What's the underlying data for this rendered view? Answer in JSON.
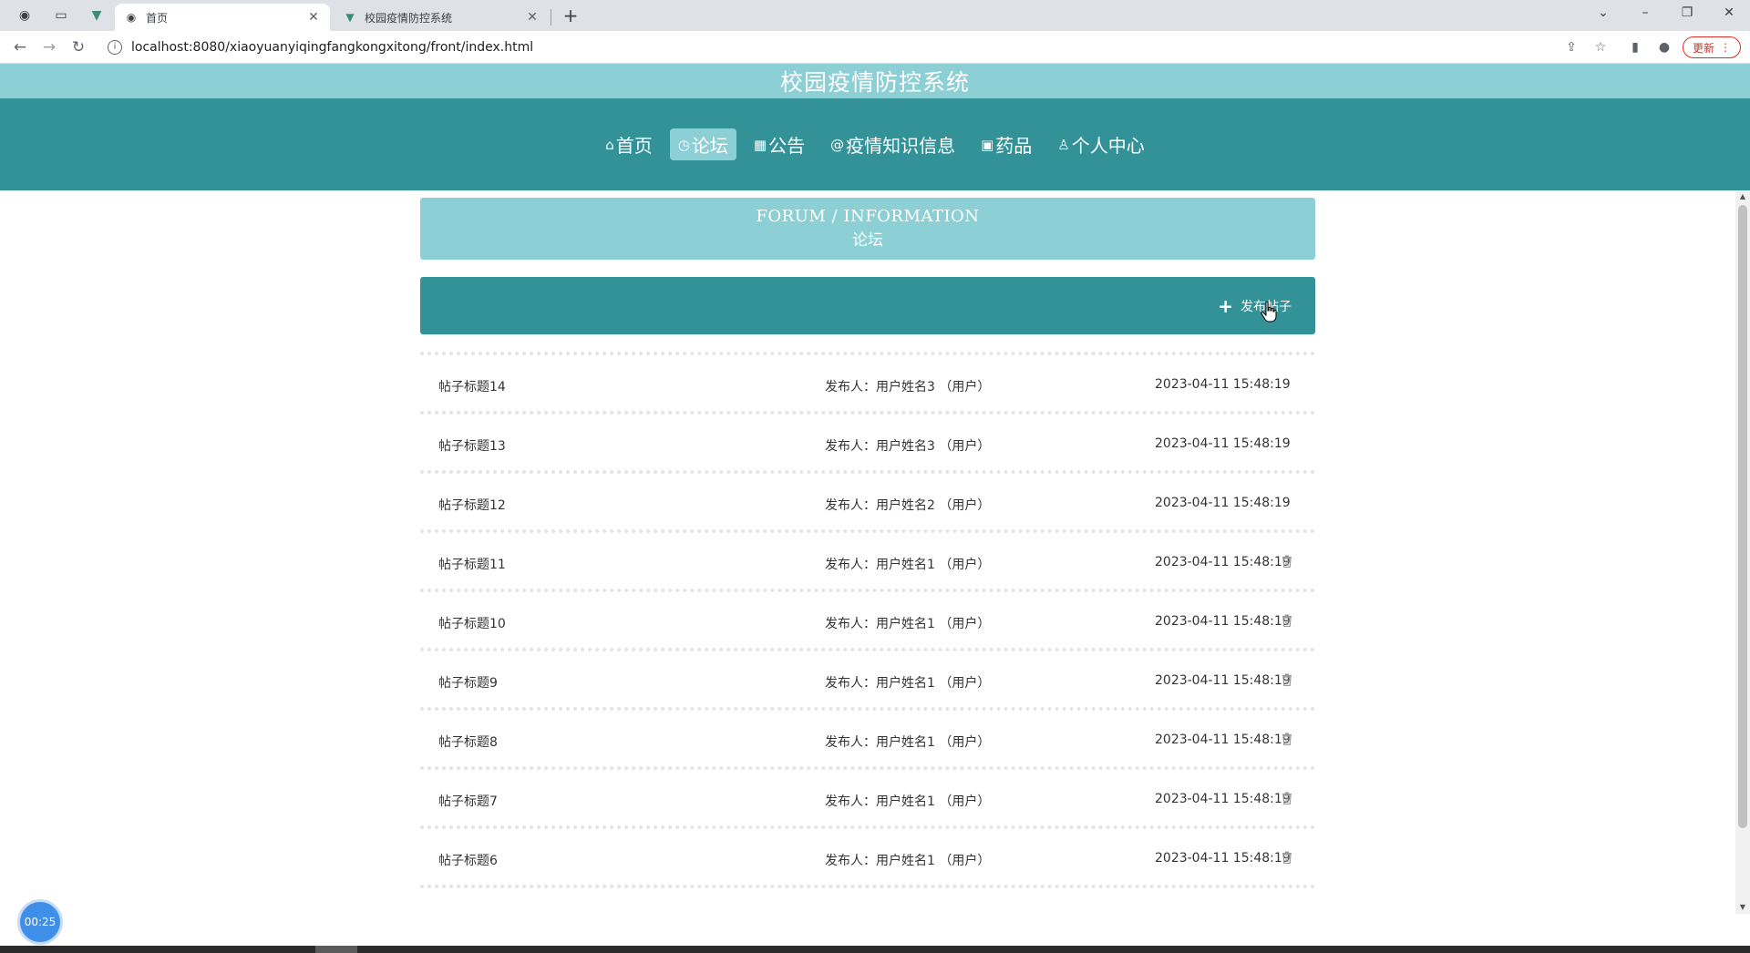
{
  "browser": {
    "tabs": [
      {
        "title": "首页",
        "active": true,
        "icon": "globe-icon"
      },
      {
        "title": "校园疫情防控系统",
        "active": false,
        "icon": "vue-icon"
      }
    ],
    "url": "localhost:8080/xiaoyuanyiqingfangkongxitong/front/index.html",
    "update_label": "更新"
  },
  "site": {
    "title": "校园疫情防控系统",
    "nav": [
      {
        "label": "首页",
        "icon": "home-icon",
        "glyph": "⌂",
        "active": false
      },
      {
        "label": "论坛",
        "icon": "clock-icon",
        "glyph": "◷",
        "active": true
      },
      {
        "label": "公告",
        "icon": "grid-icon",
        "glyph": "▦",
        "active": false
      },
      {
        "label": "疫情知识信息",
        "icon": "swirl-icon",
        "glyph": "@",
        "active": false
      },
      {
        "label": "药品",
        "icon": "apps-icon",
        "glyph": "▣",
        "active": false
      },
      {
        "label": "个人中心",
        "icon": "user-icon",
        "glyph": "♙",
        "active": false
      }
    ]
  },
  "banner": {
    "en": "FORUM / INFORMATION",
    "cn": "论坛"
  },
  "actions": {
    "post_label": "发布帖子"
  },
  "posts": [
    {
      "title": "帖子标题14",
      "author": "发布人：用户姓名3 （用户）",
      "date": "2023-04-11 15:48:19",
      "deletable": false
    },
    {
      "title": "帖子标题13",
      "author": "发布人：用户姓名3 （用户）",
      "date": "2023-04-11 15:48:19",
      "deletable": false
    },
    {
      "title": "帖子标题12",
      "author": "发布人：用户姓名2 （用户）",
      "date": "2023-04-11 15:48:19",
      "deletable": false
    },
    {
      "title": "帖子标题11",
      "author": "发布人：用户姓名1 （用户）",
      "date": "2023-04-11 15:48:19",
      "deletable": true
    },
    {
      "title": "帖子标题10",
      "author": "发布人：用户姓名1 （用户）",
      "date": "2023-04-11 15:48:19",
      "deletable": true
    },
    {
      "title": "帖子标题9",
      "author": "发布人：用户姓名1 （用户）",
      "date": "2023-04-11 15:48:19",
      "deletable": true
    },
    {
      "title": "帖子标题8",
      "author": "发布人：用户姓名1 （用户）",
      "date": "2023-04-11 15:48:19",
      "deletable": true
    },
    {
      "title": "帖子标题7",
      "author": "发布人：用户姓名1 （用户）",
      "date": "2023-04-11 15:48:19",
      "deletable": true
    },
    {
      "title": "帖子标题6",
      "author": "发布人：用户姓名1 （用户）",
      "date": "2023-04-11 15:48:19",
      "deletable": true
    }
  ],
  "timer": "00:25"
}
